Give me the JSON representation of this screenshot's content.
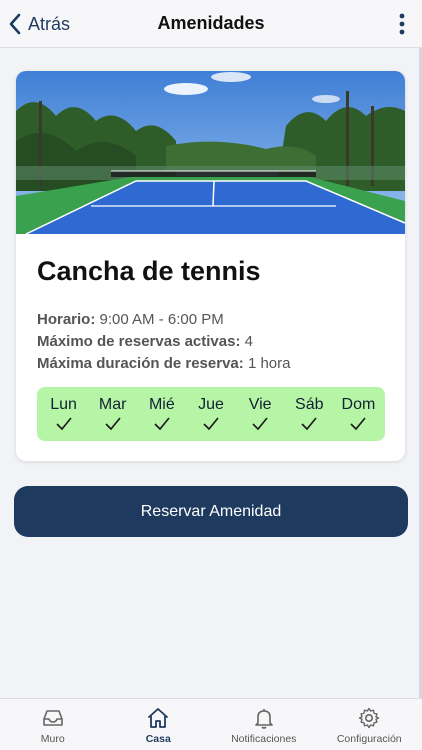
{
  "header": {
    "back_label": "Atrás",
    "title": "Amenidades"
  },
  "amenity": {
    "name": "Cancha de tennis",
    "schedule_label": "Horario:",
    "schedule_value": "9:00 AM - 6:00 PM",
    "max_active_label": "Máximo de reservas activas:",
    "max_active_value": "4",
    "max_duration_label": "Máxima duración de reserva:",
    "max_duration_value": "1 hora",
    "days": [
      {
        "label": "Lun",
        "available": true
      },
      {
        "label": "Mar",
        "available": true
      },
      {
        "label": "Mié",
        "available": true
      },
      {
        "label": "Jue",
        "available": true
      },
      {
        "label": "Vie",
        "available": true
      },
      {
        "label": "Sáb",
        "available": true
      },
      {
        "label": "Dom",
        "available": true
      }
    ]
  },
  "actions": {
    "reserve_label": "Reservar Amenidad"
  },
  "tabbar": {
    "items": [
      {
        "label": "Muro",
        "icon": "inbox-icon"
      },
      {
        "label": "Casa",
        "icon": "home-icon"
      },
      {
        "label": "Notificaciones",
        "icon": "bell-icon"
      },
      {
        "label": "Configuración",
        "icon": "gear-icon"
      }
    ],
    "active": "Casa"
  },
  "colors": {
    "primary": "#1e3a5e",
    "days_background": "#b7f5a6",
    "background": "#f2f3f7"
  }
}
